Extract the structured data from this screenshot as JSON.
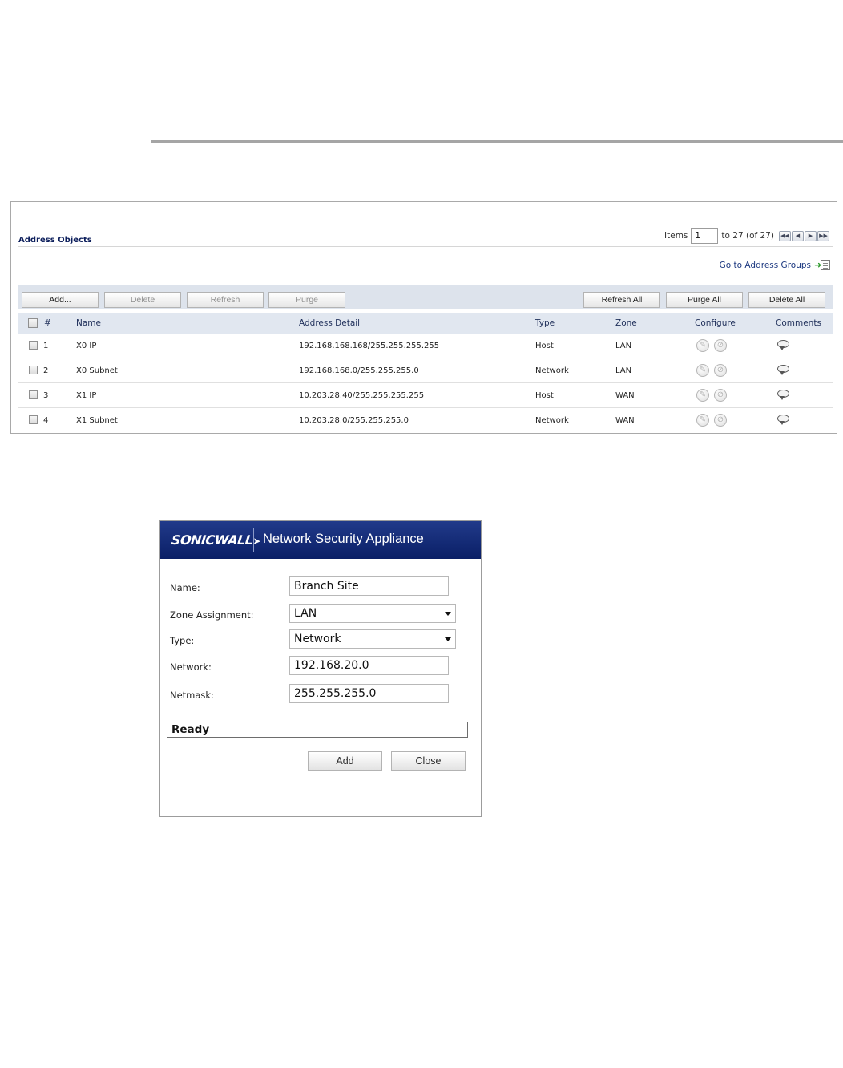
{
  "panel": {
    "title": "Address Objects",
    "pager": {
      "items_label": "Items",
      "current": "1",
      "range_text": "to 27 (of 27)",
      "buttons": [
        "first",
        "prev",
        "next",
        "last"
      ]
    },
    "goto_groups": "Go to Address Groups",
    "toolbar": {
      "add": "Add...",
      "delete": "Delete",
      "refresh": "Refresh",
      "purge": "Purge",
      "refresh_all": "Refresh All",
      "purge_all": "Purge All",
      "delete_all": "Delete All"
    },
    "columns": {
      "num": "#",
      "name": "Name",
      "detail": "Address Detail",
      "type": "Type",
      "zone": "Zone",
      "configure": "Configure",
      "comments": "Comments"
    },
    "rows": [
      {
        "num": "1",
        "name": "X0 IP",
        "detail": "192.168.168.168/255.255.255.255",
        "type": "Host",
        "zone": "LAN"
      },
      {
        "num": "2",
        "name": "X0 Subnet",
        "detail": "192.168.168.0/255.255.255.0",
        "type": "Network",
        "zone": "LAN"
      },
      {
        "num": "3",
        "name": "X1 IP",
        "detail": "10.203.28.40/255.255.255.255",
        "type": "Host",
        "zone": "WAN"
      },
      {
        "num": "4",
        "name": "X1 Subnet",
        "detail": "10.203.28.0/255.255.255.0",
        "type": "Network",
        "zone": "WAN"
      }
    ]
  },
  "dialog": {
    "brand": "SONICWALL",
    "title": "Network Security Appliance",
    "fields": {
      "name_label": "Name:",
      "name_value": "Branch  Site",
      "zone_label": "Zone Assignment:",
      "zone_value": "LAN",
      "type_label": "Type:",
      "type_value": "Network",
      "network_label": "Network:",
      "network_value": "192.168.20.0",
      "netmask_label": "Netmask:",
      "netmask_value": "255.255.255.0"
    },
    "status": "Ready",
    "add_button": "Add",
    "close_button": "Close"
  },
  "colors": {
    "header_blue": "#0d2572",
    "link_blue": "#1c3880",
    "toolbar_bg": "#dde3ec"
  }
}
